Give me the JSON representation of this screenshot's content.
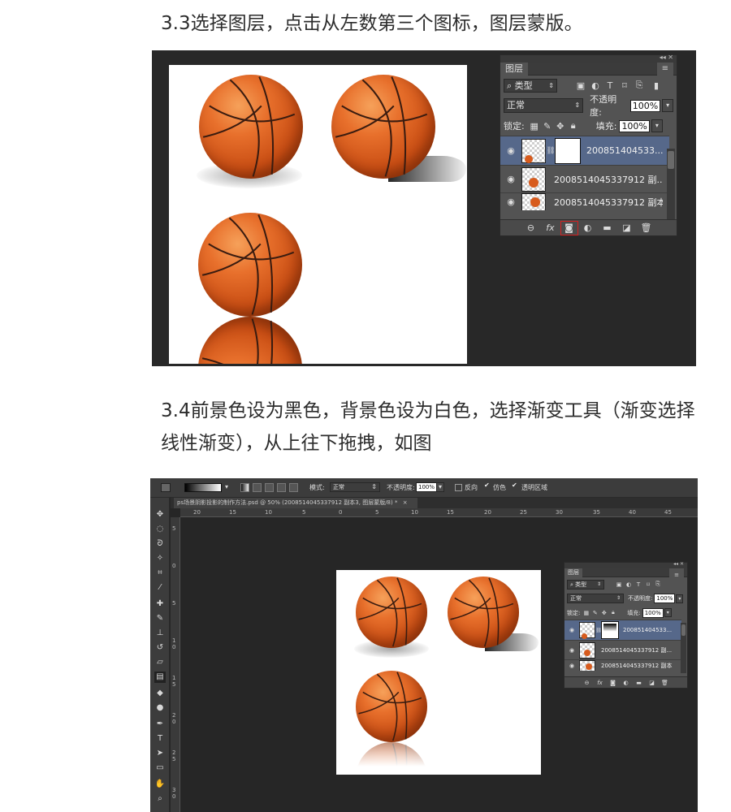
{
  "step1": {
    "text": "3.3选择图层，点击从左数第三个图标，图层蒙版。"
  },
  "step2": {
    "text": "3.4前景色设为黑色，背景色设为白色，选择渐变工具（渐变选择线性渐变），从上往下拖拽，如图"
  },
  "layers_panel": {
    "title": "图层",
    "kind_filter": "类型",
    "blend_mode": "正常",
    "opacity_label": "不透明度:",
    "opacity_value": "100%",
    "lock_label": "锁定:",
    "fill_label": "填充:",
    "fill_value": "100%",
    "layers": [
      {
        "name": "200851404533...",
        "selected": true,
        "has_mask": true
      },
      {
        "name": "2008514045337912 副...",
        "selected": false,
        "has_mask": false
      },
      {
        "name": "2008514045337912 副本",
        "selected": false,
        "has_mask": false
      }
    ]
  },
  "options_bar": {
    "mode_label": "模式:",
    "mode_value": "正常",
    "opacity_label": "不透明度:",
    "opacity_value": "100%",
    "reverse_label": "反向",
    "dither_label": "仿色",
    "transparency_label": "透明区域",
    "dither_checked": true,
    "transparency_checked": true,
    "reverse_checked": false
  },
  "document_tab": {
    "title": "ps场景阴影投影的制作方法.psd @ 50% (2008514045337912 副本3, 图层蒙版/8) *",
    "close": "×"
  },
  "ruler": {
    "ticks": [
      "20",
      "15",
      "10",
      "5",
      "0",
      "5",
      "10",
      "15",
      "20",
      "25",
      "30",
      "35",
      "40",
      "45"
    ]
  },
  "ruler_v": {
    "ticks": [
      "5",
      "0",
      "5",
      "1 0",
      "1 5",
      "2 0",
      "2 5",
      "3 0"
    ]
  },
  "colors": {
    "selected_layer": "#56688a",
    "panel": "#535353",
    "ball": "#e8702c",
    "highlight_box": "#d42020"
  }
}
